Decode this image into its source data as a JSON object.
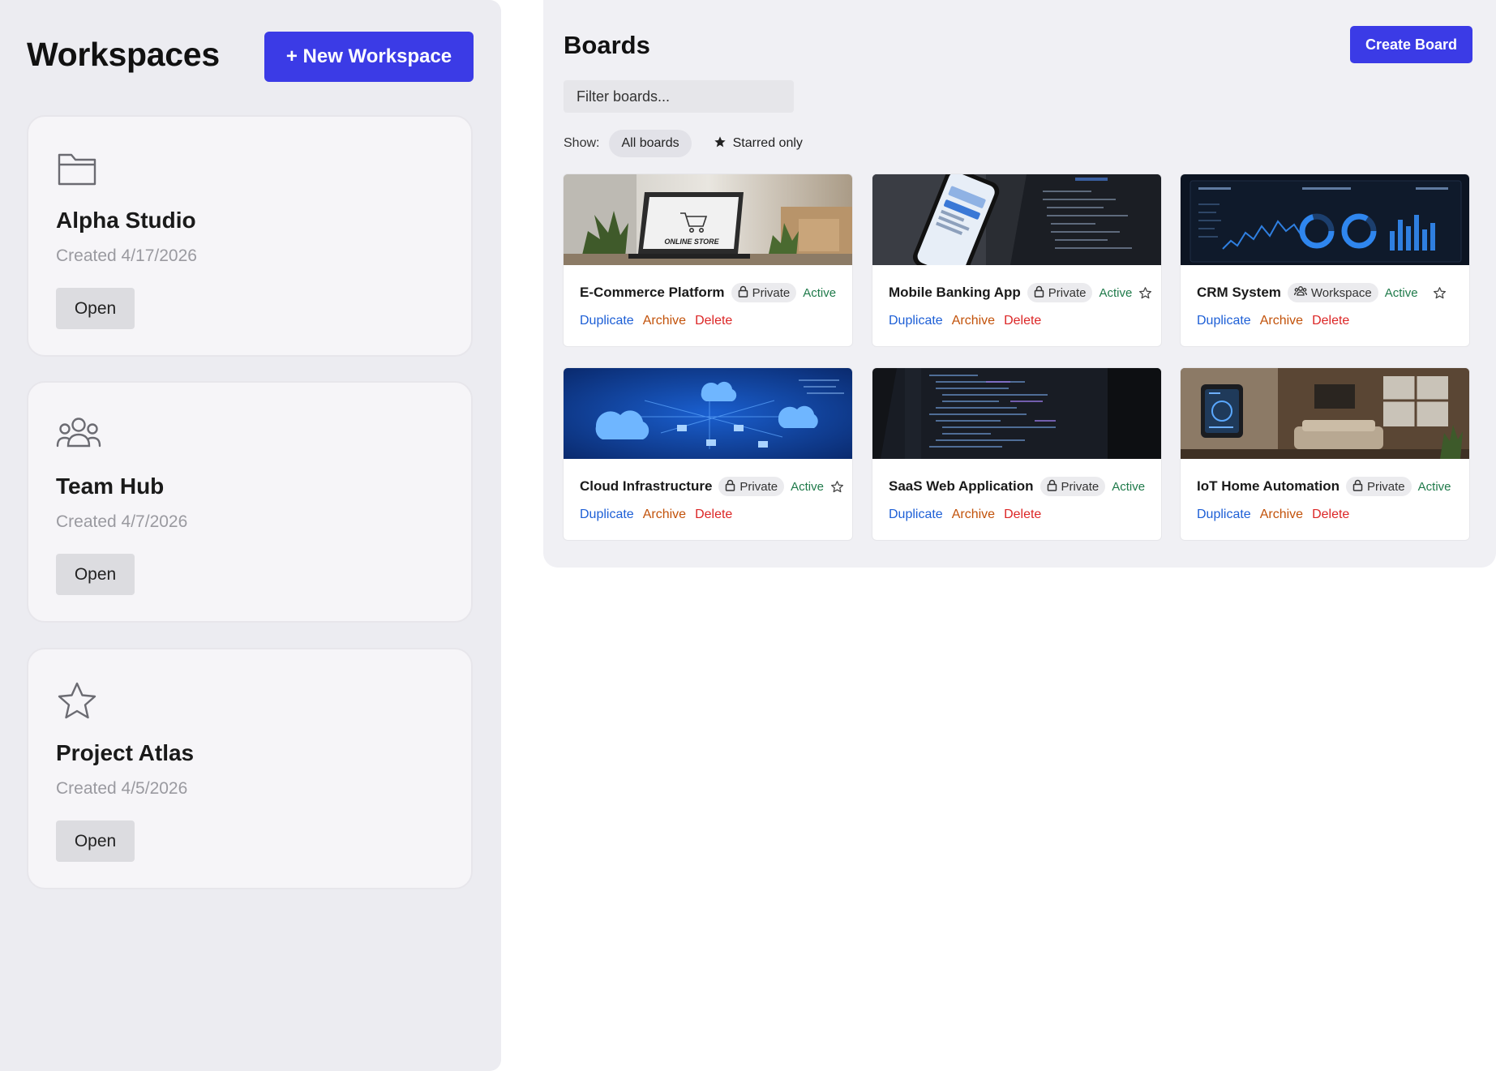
{
  "sidebar": {
    "title": "Workspaces",
    "new_button": "+ New Workspace",
    "workspaces": [
      {
        "name": "Alpha Studio",
        "created": "Created 4/17/2026",
        "icon": "folder-icon",
        "open_label": "Open"
      },
      {
        "name": "Team Hub",
        "created": "Created 4/7/2026",
        "icon": "users-icon",
        "open_label": "Open"
      },
      {
        "name": "Project Atlas",
        "created": "Created 4/5/2026",
        "icon": "star-icon",
        "open_label": "Open"
      }
    ]
  },
  "boards": {
    "title": "Boards",
    "create_button": "Create Board",
    "filter_placeholder": "Filter boards...",
    "show_label": "Show:",
    "filters": [
      "All boards",
      "Starred only"
    ],
    "cards": [
      {
        "name": "E-Commerce Platform",
        "visibility": "Private",
        "status": "Active",
        "starred": false,
        "thumbnail": "online-store-laptop",
        "thumb_text": "ONLINE STORE"
      },
      {
        "name": "Mobile Banking App",
        "visibility": "Private",
        "status": "Active",
        "starred": false,
        "thumbnail": "mobile-banking-phone"
      },
      {
        "name": "CRM System",
        "visibility": "Workspace",
        "status": "Active",
        "starred": false,
        "thumbnail": "crm-dashboard"
      },
      {
        "name": "Cloud Infrastructure",
        "visibility": "Private",
        "status": "Active",
        "starred": false,
        "thumbnail": "cloud-network"
      },
      {
        "name": "SaaS Web Application",
        "visibility": "Private",
        "status": "Active",
        "starred": false,
        "thumbnail": "code-editor"
      },
      {
        "name": "IoT Home Automation",
        "visibility": "Private",
        "status": "Active",
        "starred": false,
        "thumbnail": "smart-home-room"
      }
    ],
    "actions": {
      "duplicate": "Duplicate",
      "archive": "Archive",
      "delete": "Delete"
    }
  },
  "colors": {
    "accent": "#3b3be6",
    "active_status": "#1f7a4a",
    "duplicate": "#1d5fd6",
    "archive": "#c2520a",
    "delete": "#dc2626"
  }
}
